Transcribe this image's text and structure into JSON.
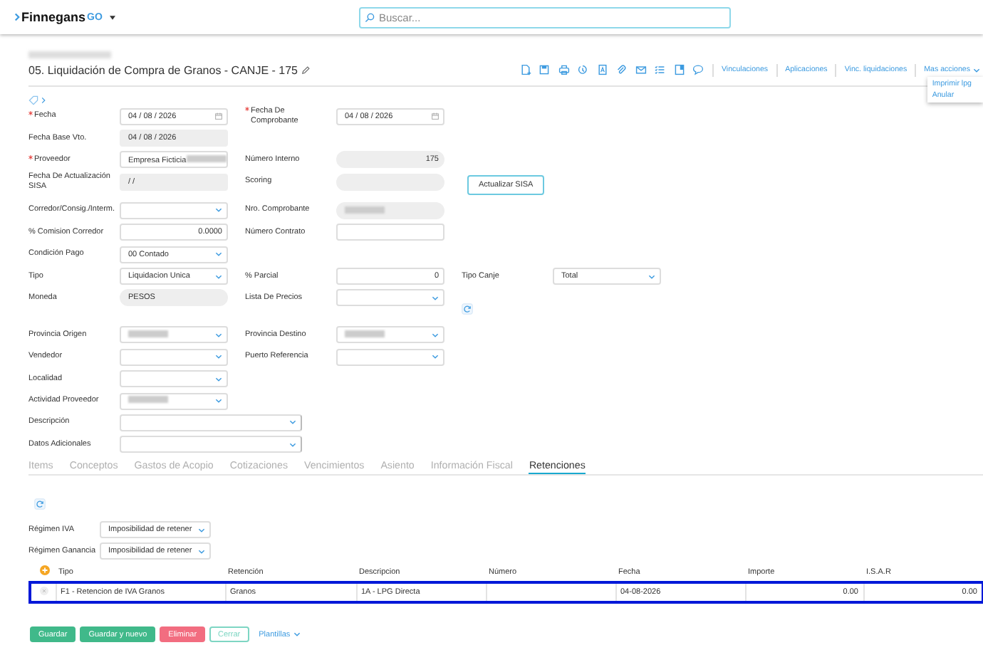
{
  "app": {
    "brand": "Finnegans",
    "product": "GO"
  },
  "search": {
    "placeholder": "Buscar..."
  },
  "breadcrumb": {
    "redacted": true
  },
  "title": "05. Liquidación de Compra de Granos - CANJE - 175",
  "toolbar_links": [
    "Vinculaciones",
    "Aplicaciones",
    "Vinc. liquidaciones"
  ],
  "more_actions": {
    "label": "Mas acciones",
    "expanded": true,
    "items": [
      "Imprimir lpg",
      "Anular"
    ]
  },
  "form_rows": [
    {
      "fields": [
        {
          "label": "Fecha",
          "required": true,
          "kind": "date",
          "value": "04 / 08 / 2026"
        },
        {
          "label": "Fecha De Comprobante",
          "required": true,
          "kind": "date",
          "value": "04 / 08 / 2026"
        }
      ]
    },
    {
      "fields": [
        {
          "label": "Fecha Base Vto.",
          "required": false,
          "kind": "readonly",
          "value": "04 / 08 / 2026"
        }
      ]
    },
    {
      "fields": [
        {
          "label": "Proveedor",
          "required": true,
          "kind": "select",
          "value": "Empresa Ficticia",
          "redacted": true
        },
        {
          "label": "Número Interno",
          "required": false,
          "kind": "number_pill",
          "value": "175"
        }
      ]
    },
    {
      "fields": [
        {
          "label": "Fecha De Actualización SISA",
          "required": false,
          "kind": "readonly",
          "value": "/     /"
        },
        {
          "label": "Scoring",
          "required": false,
          "kind": "number_pill"
        },
        {
          "kind": "button",
          "value": "Actualizar SISA"
        }
      ]
    },
    {
      "fields": [
        {
          "label": "Corredor/Consig./Interm.",
          "required": false,
          "kind": "select"
        },
        {
          "label": "Nro. Comprobante",
          "required": false,
          "kind": "pill",
          "redacted": true
        }
      ]
    },
    {
      "fields": [
        {
          "label": "% Comision Corredor",
          "required": false,
          "kind": "number",
          "value": "0.0000"
        },
        {
          "label": "Número Contrato",
          "required": false,
          "kind": "number"
        }
      ]
    },
    {
      "fields": [
        {
          "label": "Condición Pago",
          "required": false,
          "kind": "select",
          "value": "00 Contado"
        }
      ]
    },
    {
      "fields": [
        {
          "label": "Tipo",
          "required": false,
          "kind": "select",
          "value": "Liquidacion Unica"
        },
        {
          "label": "% Parcial",
          "required": false,
          "kind": "number",
          "value": "0"
        },
        {
          "label": "Tipo Canje",
          "required": false,
          "kind": "select",
          "value": "Total"
        }
      ]
    },
    {
      "fields": [
        {
          "label": "Moneda",
          "required": false,
          "kind": "pill",
          "value": "PESOS"
        },
        {
          "label": "Lista De Precios",
          "required": false,
          "kind": "select"
        },
        {
          "kind": "refresh"
        }
      ]
    },
    {
      "fields": [
        {
          "label": "Provincia Origen",
          "required": false,
          "kind": "select",
          "redacted": true
        },
        {
          "label": "Provincia Destino",
          "required": false,
          "kind": "select",
          "redacted": true
        }
      ]
    },
    {
      "fields": [
        {
          "label": "Vendedor",
          "required": false,
          "kind": "select"
        },
        {
          "label": "Puerto Referencia",
          "required": false,
          "kind": "select"
        }
      ]
    },
    {
      "fields": [
        {
          "label": "Localidad",
          "required": false,
          "kind": "select"
        }
      ]
    },
    {
      "fields": [
        {
          "label": "Actividad Proveedor",
          "required": false,
          "kind": "select",
          "redacted": true
        }
      ]
    },
    {
      "fields": [
        {
          "label": "Descripción",
          "required": false,
          "kind": "wide"
        }
      ]
    },
    {
      "fields": [
        {
          "label": "Datos Adicionales",
          "required": false,
          "kind": "wide"
        }
      ]
    }
  ],
  "tabs": [
    {
      "label": "Items",
      "selected": false
    },
    {
      "label": "Conceptos",
      "selected": false
    },
    {
      "label": "Gastos de Acopio",
      "selected": false
    },
    {
      "label": "Cotizaciones",
      "selected": false
    },
    {
      "label": "Vencimientos",
      "selected": false
    },
    {
      "label": "Asiento",
      "selected": false
    },
    {
      "label": "Información Fiscal",
      "selected": false
    },
    {
      "label": "Retenciones",
      "selected": true
    }
  ],
  "regimes": [
    {
      "label": "Régimen IVA",
      "value": "Imposibilidad de retener"
    },
    {
      "label": "Régimen Ganancia",
      "value": "Imposibilidad de retener"
    }
  ],
  "table": {
    "columns": [
      {
        "label": "Tipo"
      },
      {
        "label": "Retención"
      },
      {
        "label": "Descripcion"
      },
      {
        "label": "Número"
      },
      {
        "label": "Fecha"
      },
      {
        "label": "Importe",
        "kind": "amount"
      },
      {
        "label": "I.S.A.R",
        "kind": "amount"
      }
    ],
    "rows": [
      {
        "selected": true,
        "cells": [
          "F1 - Retencion de IVA Granos",
          "Granos",
          "1A - LPG Directa",
          "",
          "04-08-2026",
          "0.00",
          "0.00"
        ]
      }
    ]
  },
  "buttons": [
    {
      "label": "Guardar",
      "kind": "primary"
    },
    {
      "label": "Guardar y nuevo",
      "kind": "primary"
    },
    {
      "label": "Eliminar",
      "kind": "danger"
    },
    {
      "label": "Cerrar",
      "kind": "outline"
    },
    {
      "label": "Plantillas",
      "kind": "link"
    }
  ]
}
